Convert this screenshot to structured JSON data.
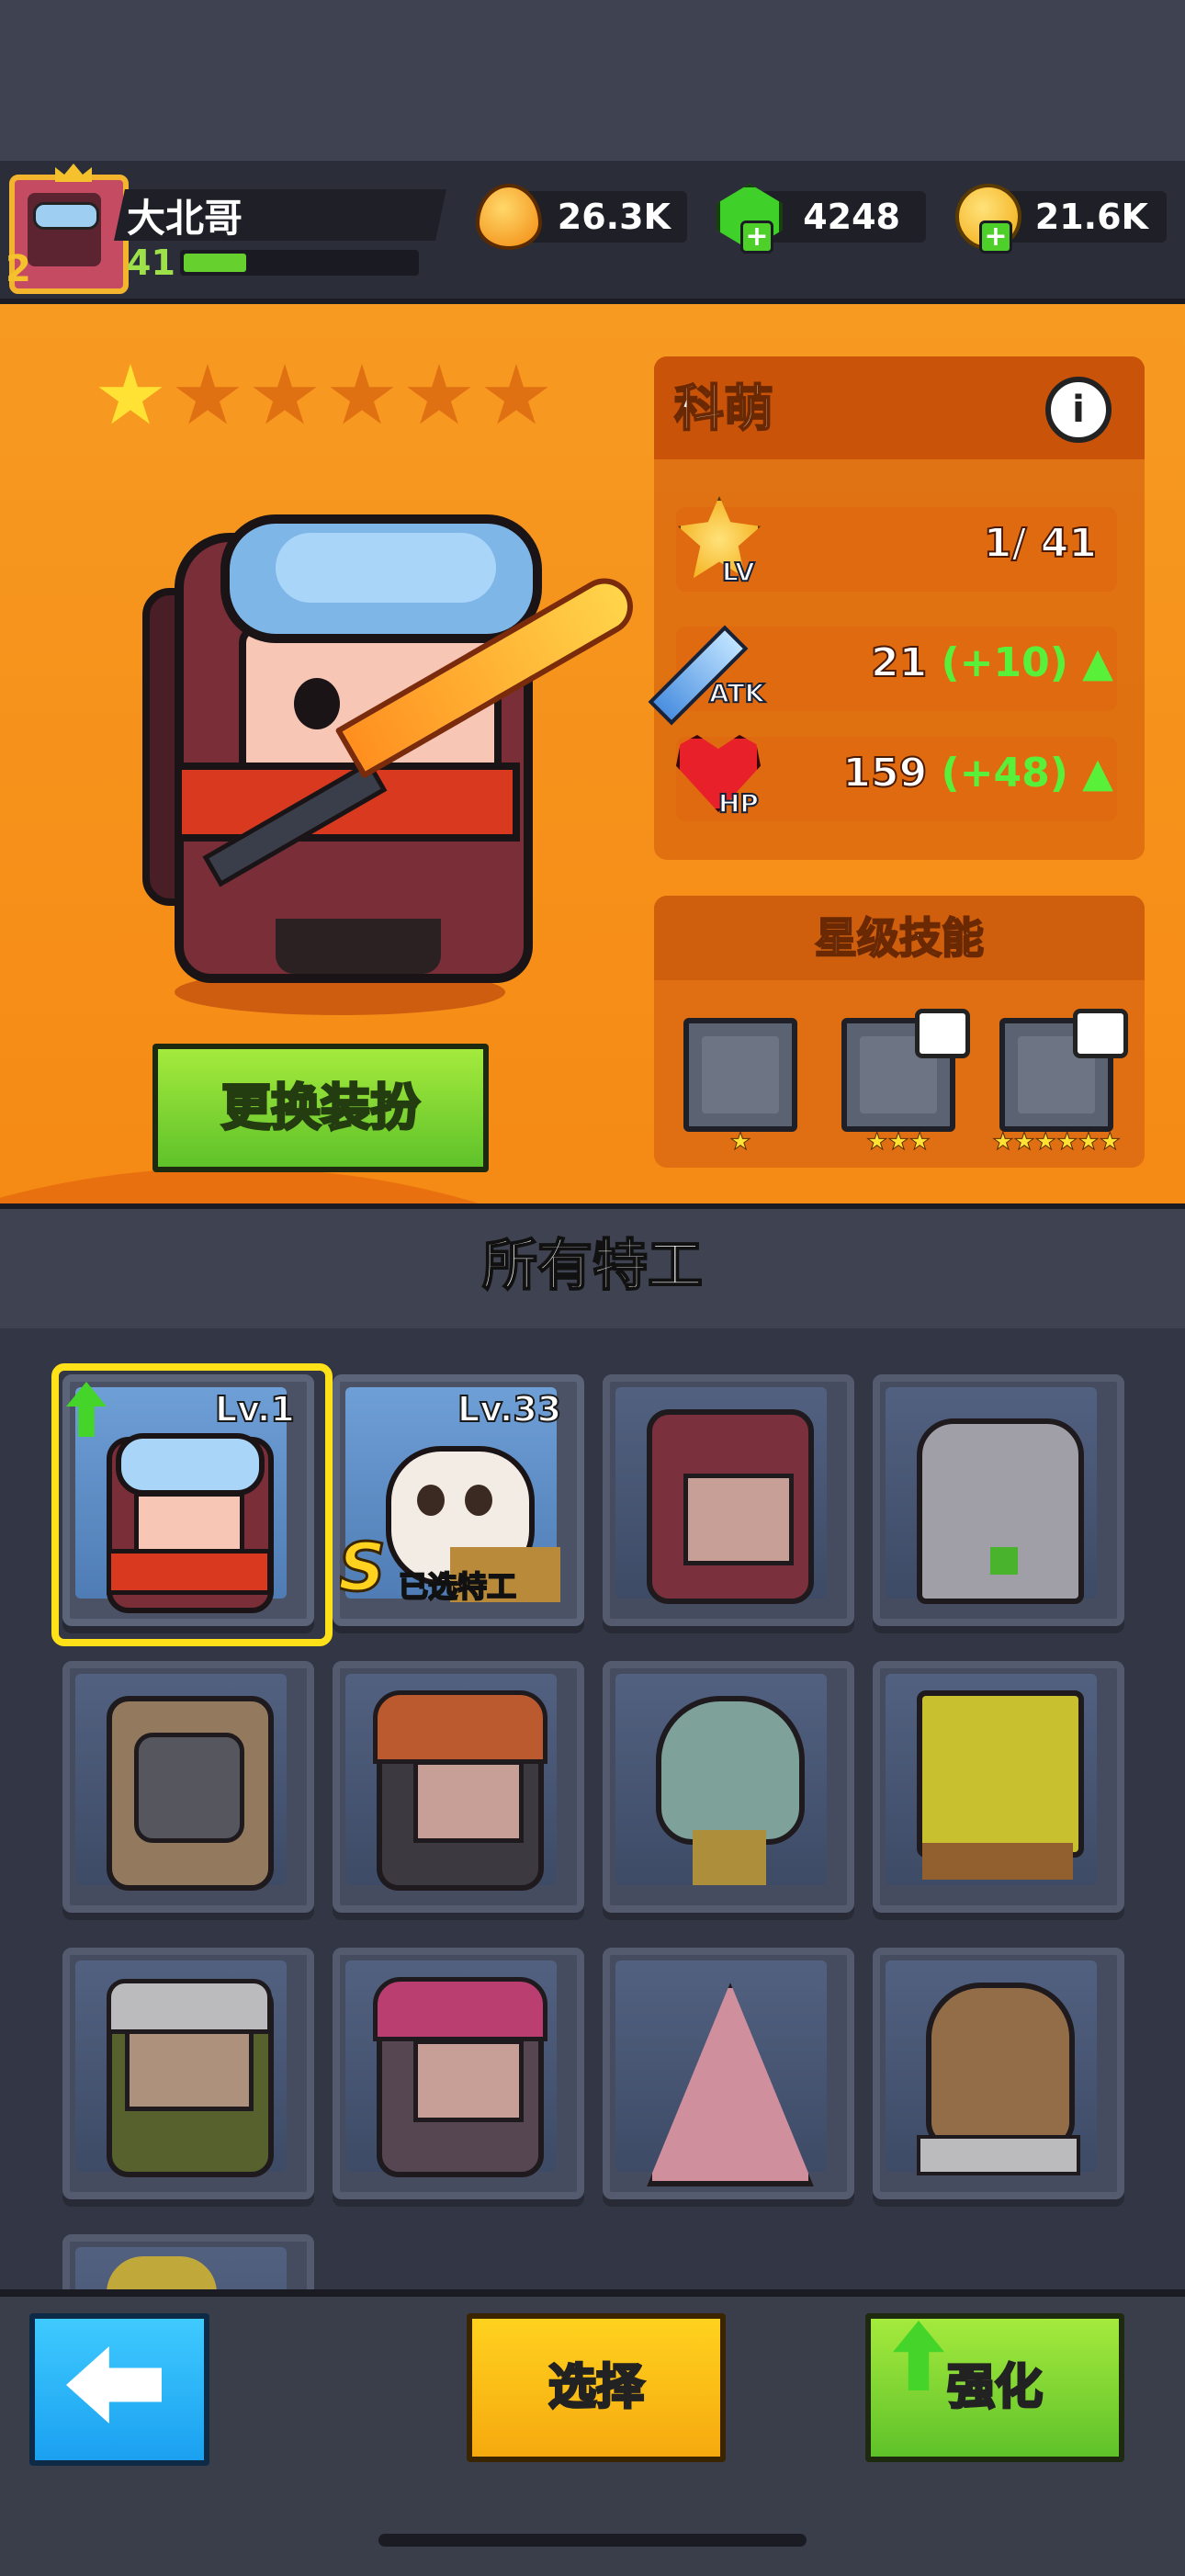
{
  "player": {
    "name": "大北哥",
    "level": "41",
    "rank": "2",
    "xp_fraction": 0.27
  },
  "resources": [
    {
      "name": "energy",
      "value": "26.3K",
      "icon": "fire-drop-icon",
      "color": "#f7a21b"
    },
    {
      "name": "gems",
      "value": "4248",
      "icon": "green-gem-icon",
      "color": "#3fd12a"
    },
    {
      "name": "coins",
      "value": "21.6K",
      "icon": "gold-coin-icon",
      "color": "#f7c21b"
    }
  ],
  "hero": {
    "name": "科萌",
    "stars_total": 6,
    "stars_filled": 1,
    "stats": [
      {
        "key": "LV",
        "value": "1/ 41",
        "bonus": ""
      },
      {
        "key": "ATK",
        "value": "21 ",
        "bonus": "(+10)"
      },
      {
        "key": "HP",
        "value": "159 ",
        "bonus": "(+48)"
      }
    ],
    "change_outfit_label": "更换装扮",
    "skills_title": "星级技能",
    "skills": [
      {
        "name": "sword-skill-icon",
        "stars": "★",
        "locked": false
      },
      {
        "name": "spin-skill-icon",
        "stars": "★★★",
        "locked": true
      },
      {
        "name": "burst-skill-icon",
        "stars": "★★★★★★",
        "locked": true
      }
    ]
  },
  "roster": {
    "title": "所有特工",
    "cards": [
      {
        "name": "agent-ninja",
        "level": "Lv.1",
        "selected_frame": true,
        "upgrade": true
      },
      {
        "name": "agent-panda",
        "level": "Lv.33",
        "badge": "S",
        "tag": "已选特工"
      },
      {
        "name": "agent-red-girl",
        "level": ""
      },
      {
        "name": "agent-cat",
        "level": ""
      },
      {
        "name": "agent-robot",
        "level": ""
      },
      {
        "name": "agent-redhead",
        "level": ""
      },
      {
        "name": "agent-squidward",
        "level": ""
      },
      {
        "name": "agent-spongebob",
        "level": ""
      },
      {
        "name": "agent-soldier",
        "level": ""
      },
      {
        "name": "agent-pink-hair",
        "level": ""
      },
      {
        "name": "agent-patrick",
        "level": ""
      },
      {
        "name": "agent-sandy",
        "level": ""
      },
      {
        "name": "agent-partial",
        "level": ""
      }
    ]
  },
  "bottom": {
    "select_label": "选择",
    "upgrade_label": "强化"
  }
}
